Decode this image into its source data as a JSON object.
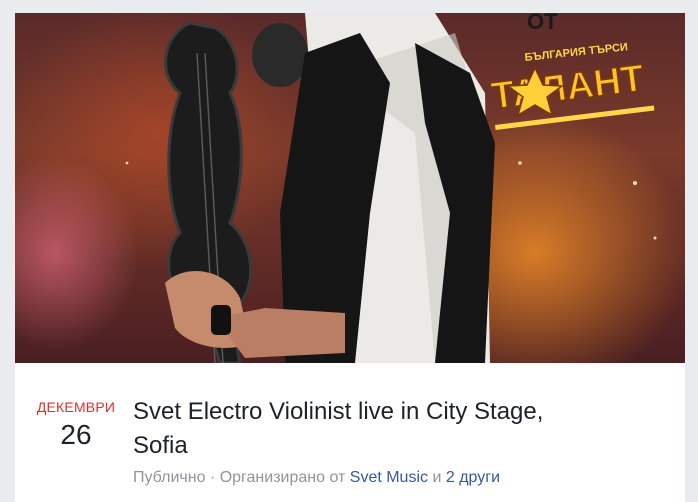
{
  "cover": {
    "logo_top_text": "ОТ",
    "logo_sub_text": "БЪЛГАРИЯ ТЪРСИ",
    "logo_main_text": "ТАЛАНТ"
  },
  "event": {
    "month": "ДЕКЕМВРИ",
    "day": "26",
    "title": "Svet Electro Violinist live in City Stage, Sofia",
    "privacy": "Публично",
    "separator": " · ",
    "organized_by": "Организирано от ",
    "organizer": "Svet Music",
    "conjunction": " и ",
    "others": "2 други"
  }
}
